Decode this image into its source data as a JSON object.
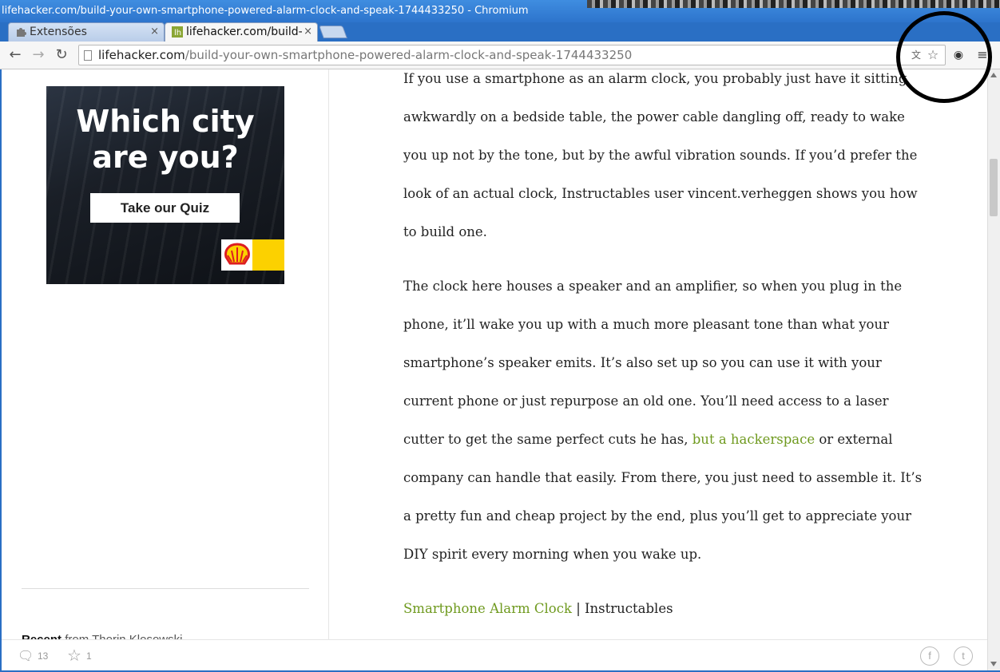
{
  "window": {
    "title": "lifehacker.com/build-your-own-smartphone-powered-alarm-clock-and-speak-1744433250 - Chromium"
  },
  "tabs": [
    {
      "label": "Extensões",
      "icon": "puzzle-icon",
      "close": "×"
    },
    {
      "label": "lifehacker.com/build-",
      "icon": "lifehacker-favicon",
      "close": "×"
    }
  ],
  "toolbar": {
    "url_host": "lifehacker.com",
    "url_path": "/build-your-own-smartphone-powered-alarm-clock-and-speak-1744433250"
  },
  "ad": {
    "headline_line1": "Which city",
    "headline_line2": "are you?",
    "button_label": "Take our Quiz",
    "brand": "shell-logo",
    "colors": {
      "yellow": "#fcd100",
      "red": "#dd1d21"
    }
  },
  "sidebar": {
    "recent_bold": "Recent",
    "recent_rest": " from Thorin Klosowski"
  },
  "article": {
    "p1": "If you use a smartphone as an alarm clock, you probably just have it sitting awkwardly on a bedside table, the power cable dangling off, ready to wake you up not by the tone, but by the awful vibration sounds. If you’d prefer the look of an actual clock, Instructables user vincent.verheggen shows you how to build one.",
    "p2_part1": "The clock here houses a speaker and an amplifier, so when you plug in the phone, it’ll wake you up with a much more pleasant tone than what your smartphone’s speaker emits. It’s also set up so you can use it with your current phone or just repurpose an old one. You’ll need access to a laser cutter to get the same perfect cuts he has, ",
    "p2_link": "but a hackerspace",
    "p2_part2": " or external company can handle that easily. From there, you just need to assemble it. It’s a pretty fun and cheap project by the end, plus you’ll get to appreciate your DIY spirit every morning when you wake up.",
    "source_link": "Smartphone Alarm Clock",
    "source_sep": " | ",
    "source_site": "Instructables",
    "link_color": "#6f9a1f"
  },
  "footer": {
    "comments_count": "13",
    "stars_count": "1"
  }
}
